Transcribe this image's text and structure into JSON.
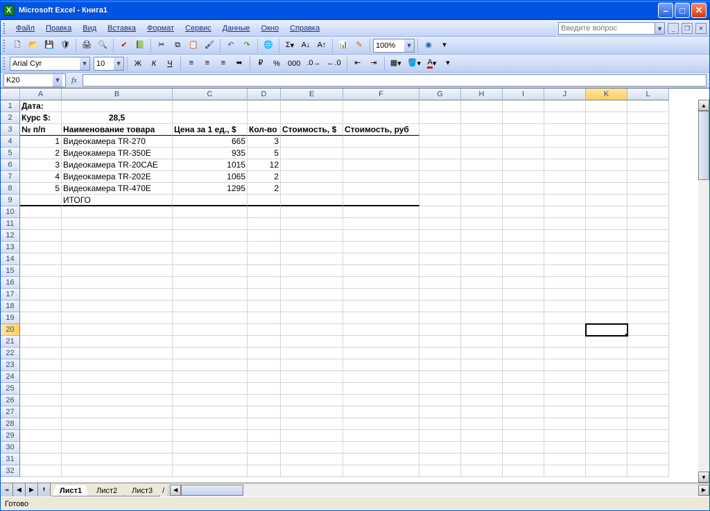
{
  "titlebar": {
    "title": "Microsoft Excel - Книга1"
  },
  "menu": {
    "items": [
      "Файл",
      "Правка",
      "Вид",
      "Вставка",
      "Формат",
      "Сервис",
      "Данные",
      "Окно",
      "Справка"
    ],
    "help_placeholder": "Введите вопрос"
  },
  "toolbar_std": {
    "zoom": "100%"
  },
  "toolbar_fmt": {
    "font": "Arial Cyr",
    "size": "10"
  },
  "formula": {
    "namebox": "K20",
    "fx_label": "fx",
    "value": ""
  },
  "columns": [
    "A",
    "B",
    "C",
    "D",
    "E",
    "F",
    "G",
    "H",
    "I",
    "J",
    "K",
    "L"
  ],
  "row_count": 32,
  "active_cell": {
    "col": "K",
    "row": 20
  },
  "cells": {
    "A1": "Дата:",
    "A2": "Курс $:",
    "B2": "28,5",
    "A3": "№ п/п",
    "B3": "Наименование товара",
    "C3": "Цена за 1 ед., $",
    "D3": "Кол-во",
    "E3": "Стоимость, $",
    "F3": "Стоимость, руб",
    "A4": "1",
    "B4": "Видеокамера TR-270",
    "C4": "665",
    "D4": "3",
    "A5": "2",
    "B5": "Видеокамера TR-350E",
    "C5": "935",
    "D5": "5",
    "A6": "3",
    "B6": "Видеокамера TR-20CAE",
    "C6": "1015",
    "D6": "12",
    "A7": "4",
    "B7": "Видеокамера TR-202E",
    "C7": "1065",
    "D7": "2",
    "A8": "5",
    "B8": "Видеокамера TR-470E",
    "C8": "1295",
    "D8": "2",
    "B9": "ИТОГО"
  },
  "tabs": {
    "items": [
      "Лист1",
      "Лист2",
      "Лист3"
    ],
    "active": 0
  },
  "status": {
    "text": "Готово"
  }
}
